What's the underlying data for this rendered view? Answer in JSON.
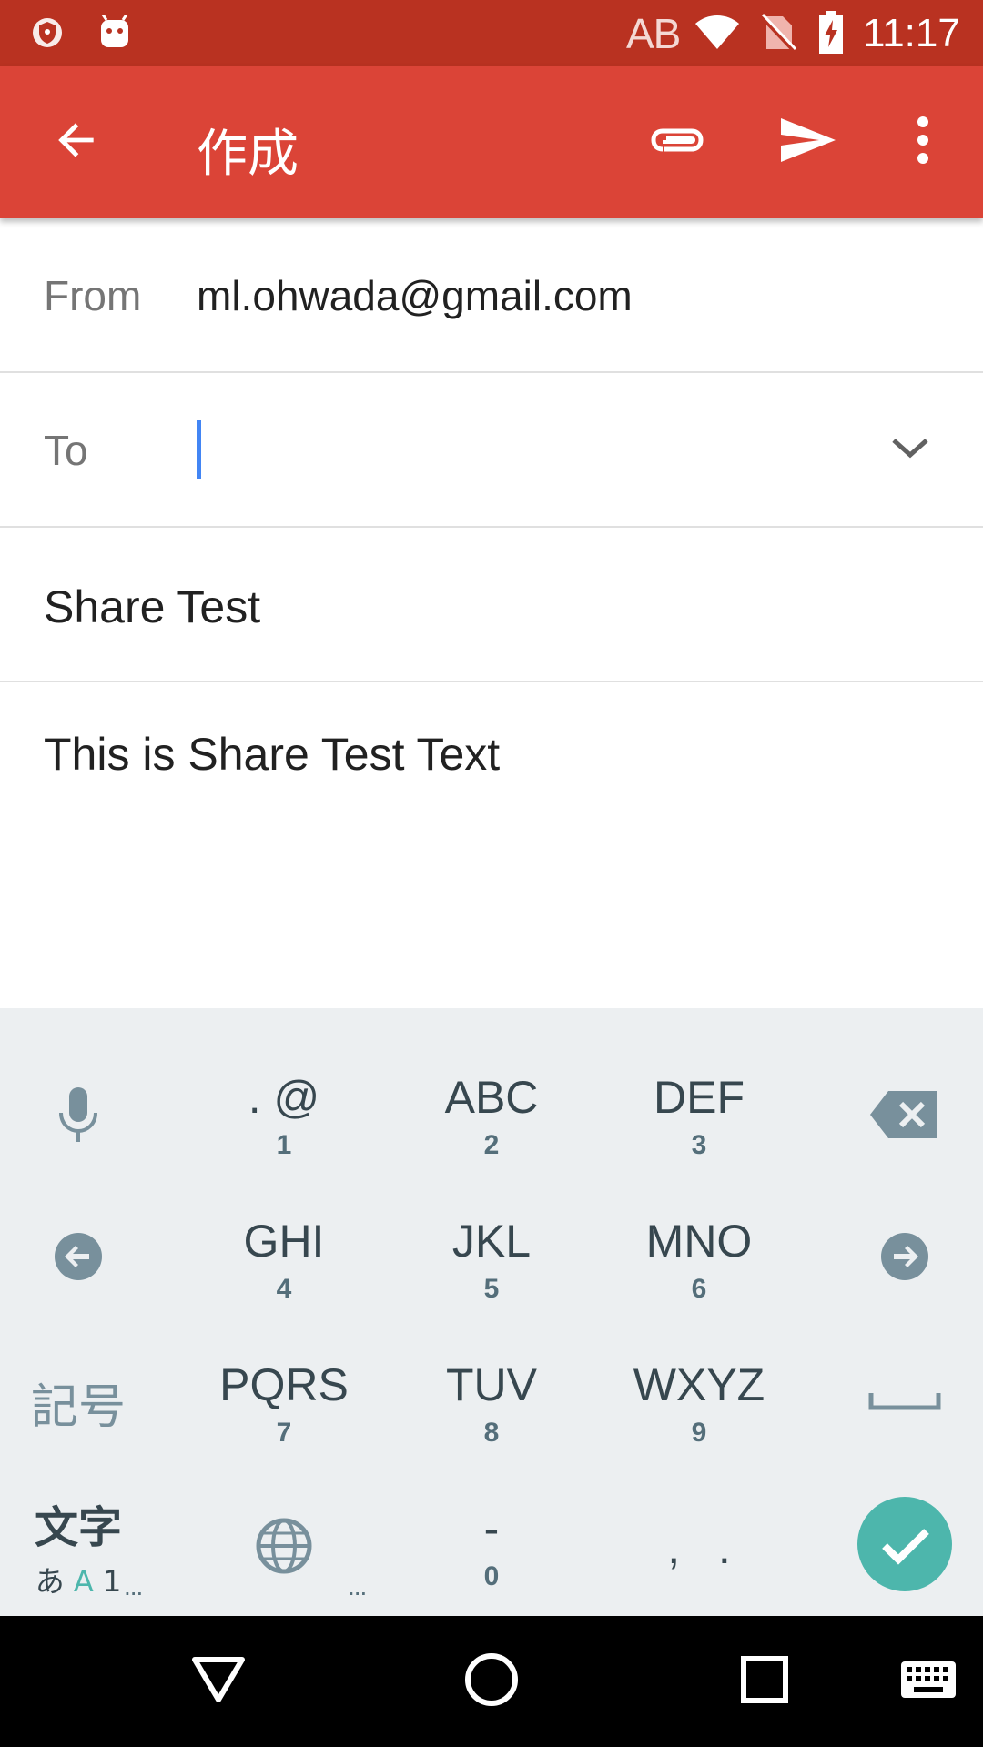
{
  "status_bar": {
    "ime_indicator": "AB",
    "time": "11:17",
    "icons": [
      "vpn-shield-icon",
      "android-debug-icon",
      "wifi-icon",
      "no-sim-icon",
      "battery-charging-icon"
    ]
  },
  "toolbar": {
    "title": "作成",
    "back_icon": "arrow-back-icon",
    "attach_icon": "paperclip-icon",
    "send_icon": "send-icon",
    "more_icon": "more-vert-icon",
    "color": "#db4437"
  },
  "compose": {
    "from_label": "From",
    "from_value": "ml.ohwada@gmail.com",
    "to_label": "To",
    "to_value": "",
    "subject": "Share Test",
    "body": "This is Share Test Text"
  },
  "keyboard": {
    "rows": [
      [
        {
          "main": ". @",
          "num": "1"
        },
        {
          "main": "ABC",
          "num": "2"
        },
        {
          "main": "DEF",
          "num": "3"
        }
      ],
      [
        {
          "main": "GHI",
          "num": "4"
        },
        {
          "main": "JKL",
          "num": "5"
        },
        {
          "main": "MNO",
          "num": "6"
        }
      ],
      [
        {
          "main": "PQRS",
          "num": "7"
        },
        {
          "main": "TUV",
          "num": "8"
        },
        {
          "main": "WXYZ",
          "num": "9"
        }
      ]
    ],
    "bottom": {
      "dash": "-",
      "zero": "0",
      "punct": ",   ."
    },
    "symbol_key": "記号",
    "mode_key_top": "文字",
    "mode_key_bottom_a": "あ",
    "mode_key_bottom_b": "A",
    "mode_key_bottom_c": "1",
    "more_dots": "...",
    "accent_color": "#4db6ac"
  },
  "nav_bar": {
    "icons": [
      "back-triangle-icon",
      "home-circle-icon",
      "recents-square-icon",
      "keyboard-icon"
    ]
  }
}
